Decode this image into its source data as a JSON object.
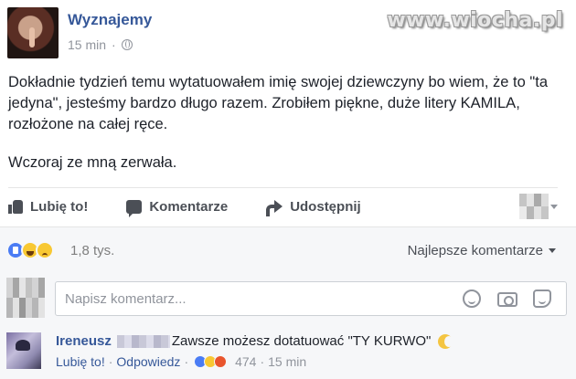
{
  "post": {
    "author": "Wyznajemy",
    "time": "15 min",
    "separator": "·",
    "paragraphs": [
      "Dokładnie tydzień temu wytatuowałem imię swojej dziewczyny bo wiem, że to \"ta jedyna\", jesteśmy bardzo długo razem. Zrobiłem piękne, duże litery KAMILA, rozłożone na całej ręce.",
      "Wczoraj ze mną zerwała."
    ]
  },
  "watermark": "www.wiocha.pl",
  "actions": {
    "like": "Lubię to!",
    "comment": "Komentarze",
    "share": "Udostępnij"
  },
  "reactions": {
    "icons": [
      "like",
      "haha",
      "sad"
    ],
    "count": "1,8 tys.",
    "sort_label": "Najlepsze komentarze"
  },
  "comment_box": {
    "placeholder": "Napisz komentarz..."
  },
  "reply": {
    "author": "Ireneusz",
    "text": "Zawsze możesz dotatuować \"TY KURWO\"",
    "like": "Lubię to!",
    "dot1": "·",
    "answer": "Odpowiedz",
    "dot2": "·",
    "reaction_count": "474",
    "dot3": "·",
    "time": "15 min"
  },
  "icons": {
    "globe": "globe-icon",
    "like": "thumbs-up-icon",
    "comment": "comment-icon",
    "share": "share-arrow-icon",
    "emoji": "emoji-icon",
    "camera": "camera-icon",
    "sticker": "sticker-icon"
  },
  "colors": {
    "link": "#365899",
    "text": "#1d2129",
    "muted": "#90949c",
    "bar_bg": "#f6f7f9",
    "like_blue": "#4a7cf4",
    "emoji_yellow": "#f8c833"
  }
}
